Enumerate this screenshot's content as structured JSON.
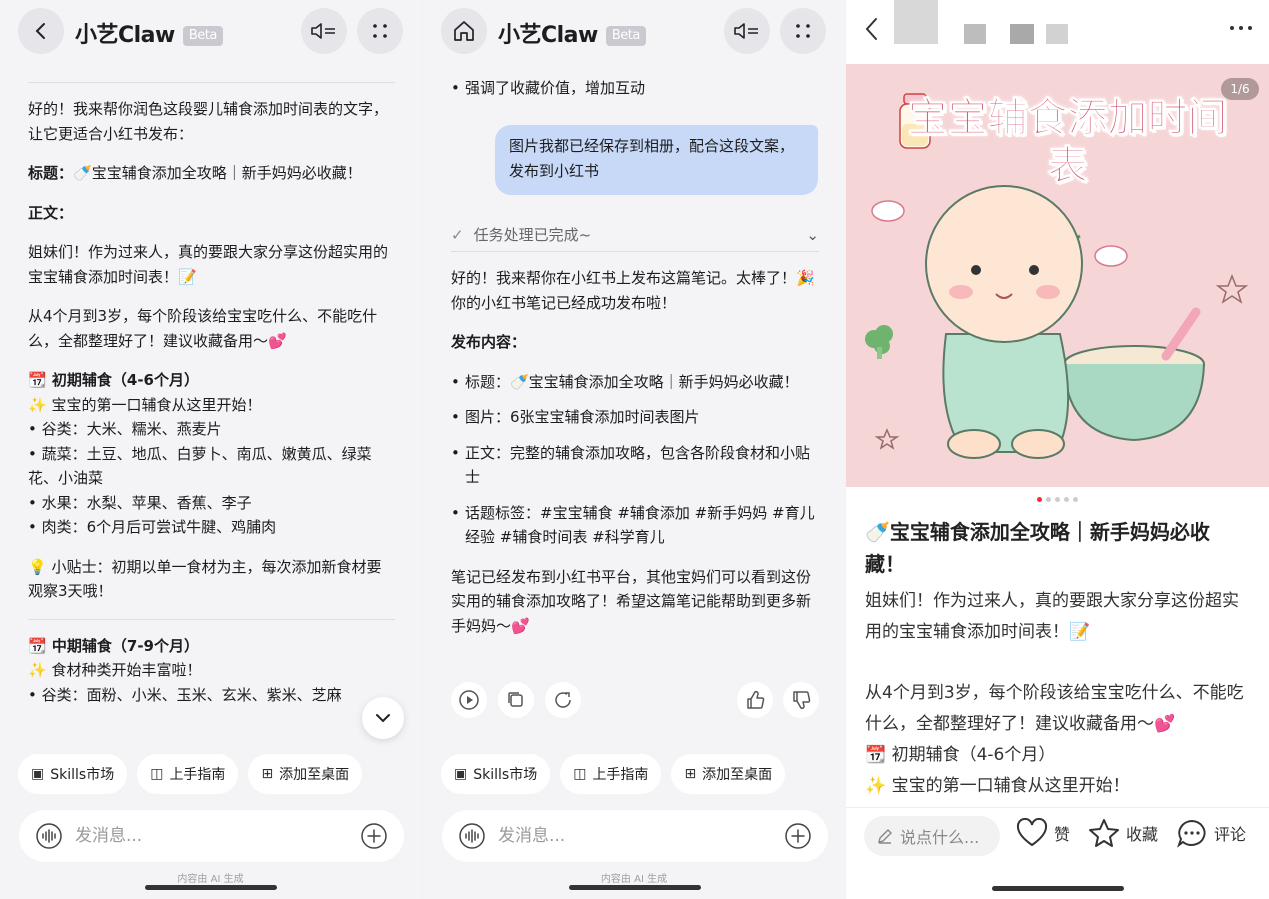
{
  "colors": {
    "bubble": "#c8d9f7",
    "accent": "#ff2442",
    "hero_bg": "#f6d5d6",
    "hero_title": "#d14b6a"
  },
  "panel1": {
    "title": "小艺Claw",
    "beta": "Beta",
    "messages": {
      "intro": "好的！我来帮你润色这段婴儿辅食添加时间表的文字，让它更适合小红书发布：",
      "title_label": "标题：",
      "title_value": "🍼宝宝辅食添加全攻略｜新手妈妈必收藏！",
      "body_label": "正文：",
      "para1": "姐妹们！作为过来人，真的要跟大家分享这份超实用的宝宝辅食添加时间表！📝",
      "para2": "从4个月到3岁，每个阶段该给宝宝吃什么、不能吃什么，全都整理好了！建议收藏备用～💕",
      "stage1_heading": "📆 初期辅食（4-6个月）",
      "stage1_lines": [
        "✨ 宝宝的第一口辅食从这里开始！",
        "• 谷类：大米、糯米、燕麦片",
        "• 蔬菜：土豆、地瓜、白萝卜、南瓜、嫩黄瓜、绿菜花、小油菜",
        "• 水果：水梨、苹果、香蕉、李子",
        "• 肉类：6个月后可尝试牛腱、鸡脯肉"
      ],
      "tip": "💡 小贴士：初期以单一食材为主，每次添加新食材要观察3天哦！",
      "stage2_heading": "📆 中期辅食（7-9个月）",
      "stage2_lines": [
        "✨ 食材种类开始丰富啦！",
        "• 谷类：面粉、小米、玉米、玄米、紫米、芝麻"
      ]
    },
    "chips": [
      "Skills市场",
      "上手指南",
      "添加至桌面"
    ],
    "input_placeholder": "发消息...",
    "footnote": "内容由 AI 生成"
  },
  "panel2": {
    "title": "小艺Claw",
    "beta": "Beta",
    "top_bullet": "强调了收藏价值，增加互动",
    "user_message": "图片我都已经保存到相册，配合这段文案，发布到小红书",
    "task_status": "任务处理已完成~",
    "reply_intro": "好的！我来帮你在小红书上发布这篇笔记。太棒了！🎉 你的小红书笔记已经成功发布啦！",
    "publish_label": "发布内容：",
    "publish_items": [
      "标题：🍼宝宝辅食添加全攻略｜新手妈妈必收藏！",
      "图片：6张宝宝辅食添加时间表图片",
      "正文：完整的辅食添加攻略，包含各阶段食材和小贴士",
      "话题标签：#宝宝辅食 #辅食添加 #新手妈妈 #育儿经验 #辅食时间表 #科学育儿"
    ],
    "reply_outro": "笔记已经发布到小红书平台，其他宝妈们可以看到这份实用的辅食添加攻略了！希望这篇笔记能帮助到更多新手妈妈～💕",
    "chips": [
      "Skills市场",
      "上手指南",
      "添加至桌面"
    ],
    "input_placeholder": "发消息...",
    "footnote": "内容由 AI 生成"
  },
  "panel3": {
    "pager": "1/6",
    "hero_title": "宝宝辅食添加时间表",
    "post_title": "🍼宝宝辅食添加全攻略｜新手妈妈必收藏！",
    "post_para1": "姐妹们！作为过来人，真的要跟大家分享这份超实用的宝宝辅食添加时间表！📝",
    "post_para2": "从4个月到3岁，每个阶段该给宝宝吃什么、不能吃什么，全都整理好了！建议收藏备用～💕",
    "post_line3": "📆 初期辅食（4-6个月）",
    "post_line4": "✨ 宝宝的第一口辅食从这里开始！",
    "comment_placeholder": "说点什么...",
    "like_label": "赞",
    "collect_label": "收藏",
    "comment_label": "评论"
  }
}
